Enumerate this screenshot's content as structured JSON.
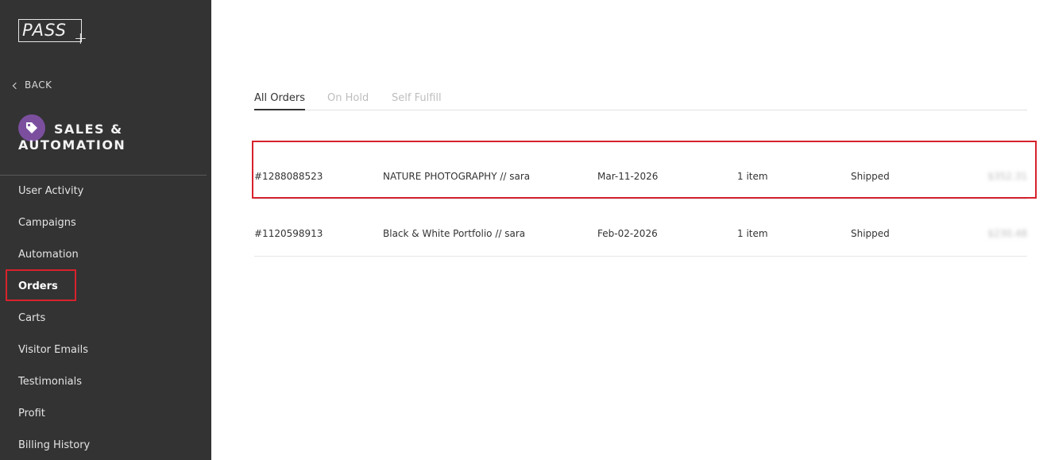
{
  "brand": {
    "logo_text": "PASS",
    "logo_plus": "+"
  },
  "sidebar": {
    "back_label": "BACK",
    "section_title": "SALES & AUTOMATION",
    "section_icon": "tag-icon",
    "items": [
      {
        "label": "User Activity"
      },
      {
        "label": "Campaigns"
      },
      {
        "label": "Automation"
      },
      {
        "label": "Orders",
        "active": true
      },
      {
        "label": "Carts"
      },
      {
        "label": "Visitor Emails"
      },
      {
        "label": "Testimonials"
      },
      {
        "label": "Profit"
      },
      {
        "label": "Billing History"
      }
    ]
  },
  "tabs": [
    {
      "label": "All Orders",
      "active": true
    },
    {
      "label": "On Hold"
    },
    {
      "label": "Self Fulfill"
    }
  ],
  "orders": [
    {
      "id": "#1288088523",
      "name": "NATURE PHOTOGRAPHY // sara",
      "date": "Mar-11-2026",
      "items": "1 item",
      "status": "Shipped",
      "total": "$352.31"
    },
    {
      "id": "#1120598913",
      "name": "Black & White Portfolio // sara",
      "date": "Feb-02-2026",
      "items": "1 item",
      "status": "Shipped",
      "total": "$230.48"
    }
  ],
  "colors": {
    "sidebar_bg": "#333333",
    "accent_purple": "#7b4f9e",
    "highlight_red": "#d7222c"
  }
}
